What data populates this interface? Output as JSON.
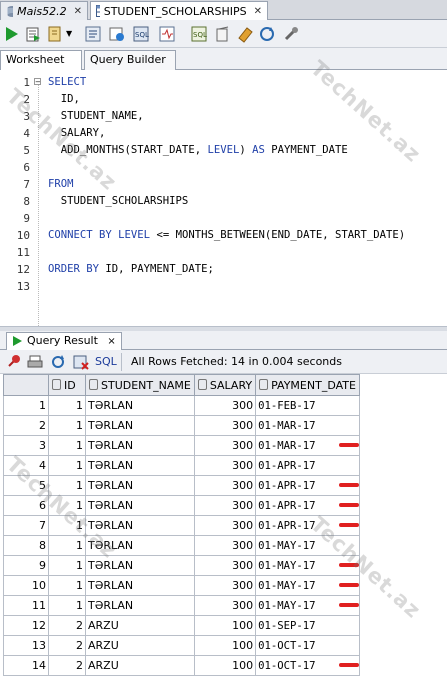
{
  "doc_tabs": [
    {
      "label": "Mais52.2",
      "icon": "database-connection-icon"
    },
    {
      "label": "STUDENT_SCHOLARSHIPS",
      "icon": "table-icon"
    }
  ],
  "worksheet_tabs": [
    "Worksheet",
    "Query Builder"
  ],
  "editor": {
    "lines": [
      {
        "n": "1",
        "text": "SELECT"
      },
      {
        "n": "2",
        "text": "  ID,"
      },
      {
        "n": "3",
        "text": "  STUDENT_NAME,"
      },
      {
        "n": "4",
        "text": "  SALARY,"
      },
      {
        "n": "5",
        "text": "  ADD_MONTHS(START_DATE, LEVEL) AS PAYMENT_DATE"
      },
      {
        "n": "6",
        "text": ""
      },
      {
        "n": "7",
        "text": "FROM"
      },
      {
        "n": "8",
        "text": "  STUDENT_SCHOLARSHIPS"
      },
      {
        "n": "9",
        "text": ""
      },
      {
        "n": "10",
        "text": "CONNECT BY LEVEL <= MONTHS_BETWEEN(END_DATE, START_DATE)"
      },
      {
        "n": "11",
        "text": ""
      },
      {
        "n": "12",
        "text": "ORDER BY ID, PAYMENT_DATE;"
      },
      {
        "n": "13",
        "text": ""
      }
    ]
  },
  "result": {
    "tab_label": "Query Result",
    "sql_label": "SQL",
    "status": "All Rows Fetched: 14 in 0.004 seconds",
    "columns": [
      "ID",
      "STUDENT_NAME",
      "SALARY",
      "PAYMENT_DATE"
    ],
    "rows": [
      {
        "rn": "1",
        "id": "1",
        "name": "TƏRLAN",
        "salary": "300",
        "date": "01-FEB-17",
        "flag": false
      },
      {
        "rn": "2",
        "id": "1",
        "name": "TƏRLAN",
        "salary": "300",
        "date": "01-MAR-17",
        "flag": false
      },
      {
        "rn": "3",
        "id": "1",
        "name": "TƏRLAN",
        "salary": "300",
        "date": "01-MAR-17",
        "flag": true
      },
      {
        "rn": "4",
        "id": "1",
        "name": "TƏRLAN",
        "salary": "300",
        "date": "01-APR-17",
        "flag": false
      },
      {
        "rn": "5",
        "id": "1",
        "name": "TƏRLAN",
        "salary": "300",
        "date": "01-APR-17",
        "flag": true
      },
      {
        "rn": "6",
        "id": "1",
        "name": "TƏRLAN",
        "salary": "300",
        "date": "01-APR-17",
        "flag": true
      },
      {
        "rn": "7",
        "id": "1",
        "name": "TƏRLAN",
        "salary": "300",
        "date": "01-APR-17",
        "flag": true
      },
      {
        "rn": "8",
        "id": "1",
        "name": "TƏRLAN",
        "salary": "300",
        "date": "01-MAY-17",
        "flag": false
      },
      {
        "rn": "9",
        "id": "1",
        "name": "TƏRLAN",
        "salary": "300",
        "date": "01-MAY-17",
        "flag": true
      },
      {
        "rn": "10",
        "id": "1",
        "name": "TƏRLAN",
        "salary": "300",
        "date": "01-MAY-17",
        "flag": true
      },
      {
        "rn": "11",
        "id": "1",
        "name": "TƏRLAN",
        "salary": "300",
        "date": "01-MAY-17",
        "flag": true
      },
      {
        "rn": "12",
        "id": "2",
        "name": "ARZU",
        "salary": "100",
        "date": "01-SEP-17",
        "flag": false
      },
      {
        "rn": "13",
        "id": "2",
        "name": "ARZU",
        "salary": "100",
        "date": "01-OCT-17",
        "flag": false
      },
      {
        "rn": "14",
        "id": "2",
        "name": "ARZU",
        "salary": "100",
        "date": "01-OCT-17",
        "flag": true
      }
    ]
  },
  "watermark": "TechNet.az",
  "colors": {
    "keyword": "#1f3fa8",
    "mark": "#e02020",
    "run": "#1e9a2e"
  }
}
